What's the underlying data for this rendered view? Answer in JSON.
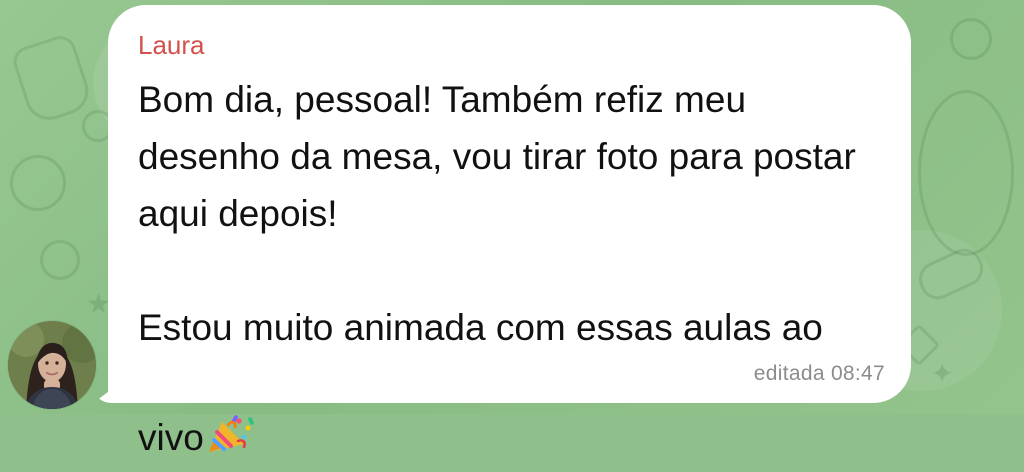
{
  "chat": {
    "sender_name": "Laura",
    "message_text": "Bom dia, pessoal! Também refiz meu desenho da mesa, vou tirar foto para postar aqui depois!\n\nEstou muito animada com essas aulas ao vivo",
    "edited_label": "editada",
    "time": "08:47",
    "emoji_icon": "party-popper-icon",
    "avatar_icon": "avatar-photo"
  },
  "colors": {
    "background": "#8fbf8a",
    "bubble": "#ffffff",
    "sender": "#d4504b",
    "meta": "#8c8c8c"
  }
}
